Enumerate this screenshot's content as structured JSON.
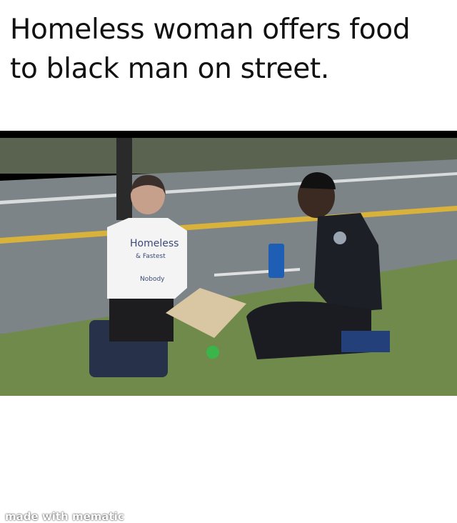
{
  "meme": {
    "caption_lines": [
      "Homeless woman offers food",
      "to black man on street."
    ],
    "shirt_text": [
      "Homeless",
      "& Fastest",
      "Nobody"
    ],
    "watermark": "made with mematic"
  },
  "colors": {
    "road": "#7d8487",
    "grass": "#6f8a4a",
    "line": "#d8b23a",
    "uniform": "#1c1f26",
    "cup": "#1e5fb5"
  }
}
